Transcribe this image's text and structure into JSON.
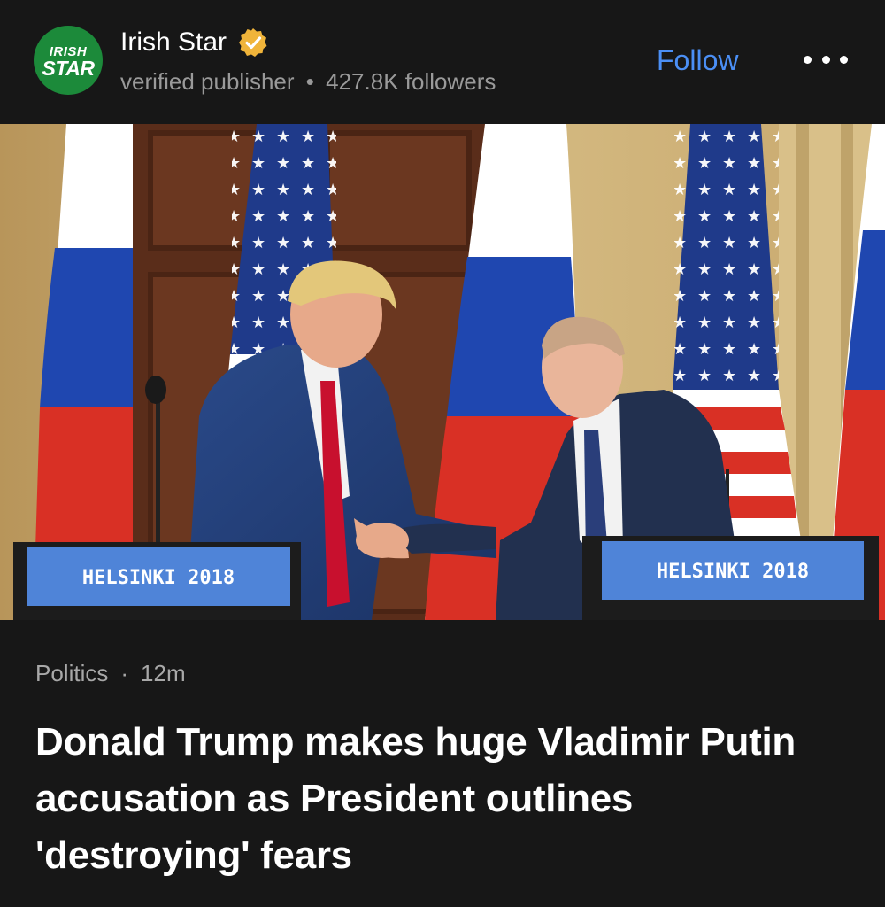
{
  "publisher": {
    "logo_text_top": "IRISH",
    "logo_text_bottom": "STAR",
    "name": "Irish Star",
    "verified_icon": "verified-check-badge",
    "status": "verified publisher",
    "separator": "•",
    "followers": "427.8K followers"
  },
  "actions": {
    "follow_label": "Follow",
    "more_icon": "more-dots-icon"
  },
  "photo": {
    "left_podium_label": "HELSINKI 2018",
    "right_podium_label": "HELSINKI 2018"
  },
  "article": {
    "category": "Politics",
    "meta_separator": "·",
    "time_ago": "12m",
    "headline": "Donald Trump makes huge Vladimir Putin accusation as President outlines 'destroying' fears"
  },
  "colors": {
    "background": "#171717",
    "accent_blue": "#4b8ff5",
    "badge_gold": "#f0b43a",
    "logo_green": "#1c8a3a"
  }
}
